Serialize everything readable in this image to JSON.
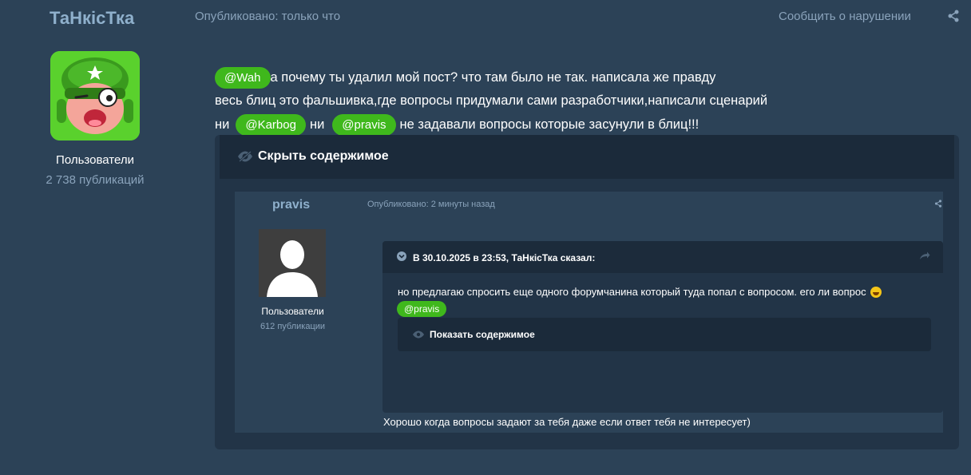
{
  "post": {
    "author": "ТаНкісТка",
    "published": "Опубликовано: только что",
    "report": "Сообщить о нарушении",
    "group": "Пользователи",
    "posts_count": "2 738 публикаций",
    "line1_mention": "@Wah",
    "line1_text": "а почему ты удалил мой пост? что там было не так. написала же правду",
    "line2_text": "весь блиц это фальшивка,где вопросы придумали сами разработчики,написали сценарий",
    "line3_pre": "ни",
    "line3_mention1": "@Karbog",
    "line3_mid": "ни",
    "line3_mention2": "@pravis",
    "line3_post": "не задавали вопросы которые засунули в блиц!!!"
  },
  "spoiler": {
    "title": "Скрыть содержимое"
  },
  "inner_post": {
    "author": "pravis",
    "published": "Опубликовано: 2 минуты назад",
    "group": "Пользователи",
    "posts_count": "612 публикации",
    "quote_title": "В 30.10.2025 в 23:53, ТаНкісТка сказал:",
    "quote_text": "но предлагаю спросить еще одного форумчанина который туда попал с вопросом. его ли вопрос",
    "quote_mention": "@pravis",
    "show_title": "Показать содержимое",
    "footer": "Хорошо когда вопросы задают за тебя даже если ответ тебя не интересует)"
  },
  "icons": {
    "share": "share-icon",
    "eye": "eye-icon",
    "eye_crossed": "eye-crossed-icon",
    "chevron": "chevron-down-icon",
    "reply": "reply-icon",
    "emoji": "laughing-emoji-icon"
  },
  "colors": {
    "background": "#2c4257",
    "mention": "#3fb81c",
    "muted": "#8aa3bb",
    "author": "#8fb0cc"
  }
}
